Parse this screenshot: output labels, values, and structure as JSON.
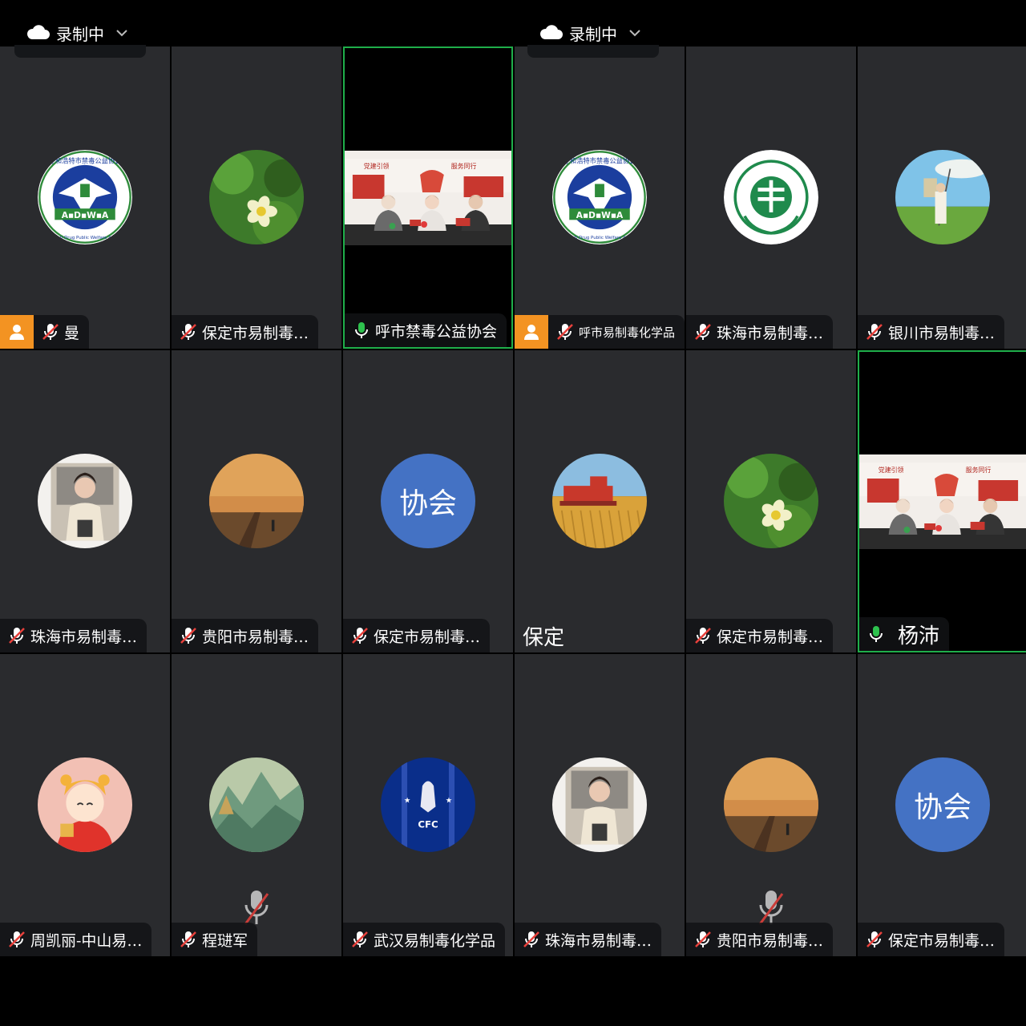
{
  "recording": [
    {
      "label": "录制中"
    },
    {
      "label": "录制中"
    }
  ],
  "tiles": [
    {
      "name": "曼",
      "host": true,
      "muted": true,
      "avatar": "hohhot-anti-drug-logo",
      "logo_text": "Hohhot Anti Drug Public Welfare Association",
      "logo_cn": "呼和浩特市禁毒公益协会",
      "logo_abbr": "A▪D▪W▪A"
    },
    {
      "name": "保定市易制毒…",
      "muted": true,
      "avatar": "green-flower-photo"
    },
    {
      "name": "呼市禁毒公益协会",
      "muted": false,
      "video": true,
      "banner_left": "党建引领",
      "banner_right": "服务同行"
    },
    {
      "name": "呼市易制毒化学品",
      "host": true,
      "muted": true,
      "avatar": "hohhot-anti-drug-logo",
      "logo_text": "Hohhot Anti Drug Public Welfare Association",
      "logo_cn": "呼和浩特市禁毒公益协会",
      "logo_abbr": "A▪D▪W▪A"
    },
    {
      "name": "珠海市易制毒…",
      "muted": true,
      "avatar": "zhuhai-chemicals-logo"
    },
    {
      "name": "银川市易制毒…",
      "muted": true,
      "avatar": "painter-illustration"
    },
    {
      "name": "珠海市易制毒…",
      "muted": true,
      "avatar": "portrait-photo"
    },
    {
      "name": "贵阳市易制毒…",
      "muted": true,
      "avatar": "sunset-photo"
    },
    {
      "name": "保定市易制毒…",
      "muted": true,
      "avatar_text": "协会"
    },
    {
      "name": "保定",
      "no_icon": true,
      "avatar": "harvester-photo"
    },
    {
      "name": "保定市易制毒…",
      "muted": true,
      "avatar": "green-flower-photo"
    },
    {
      "name": "杨沛",
      "muted": false,
      "video": true,
      "banner_left": "党建引领",
      "banner_right": "服务同行"
    },
    {
      "name": "周凯丽-中山易…",
      "muted": true,
      "avatar": "tiger-girl-illustration"
    },
    {
      "name": "程琎军",
      "muted": true,
      "avatar": "landscape-painting"
    },
    {
      "name": "武汉易制毒化学品",
      "muted": true,
      "avatar": "cfc-badge",
      "badge_text": "CFC"
    },
    {
      "name": "珠海市易制毒…",
      "muted": true,
      "avatar": "portrait-photo"
    },
    {
      "name": "贵阳市易制毒…",
      "muted": true,
      "avatar": "sunset-photo"
    },
    {
      "name": "保定市易制毒…",
      "muted": true,
      "avatar_text": "协会"
    }
  ],
  "colors": {
    "tile_bg": "#2a2b2e",
    "active_border": "#1fae4a",
    "host_badge": "#f39322",
    "text_avatar": "#4472c4"
  }
}
